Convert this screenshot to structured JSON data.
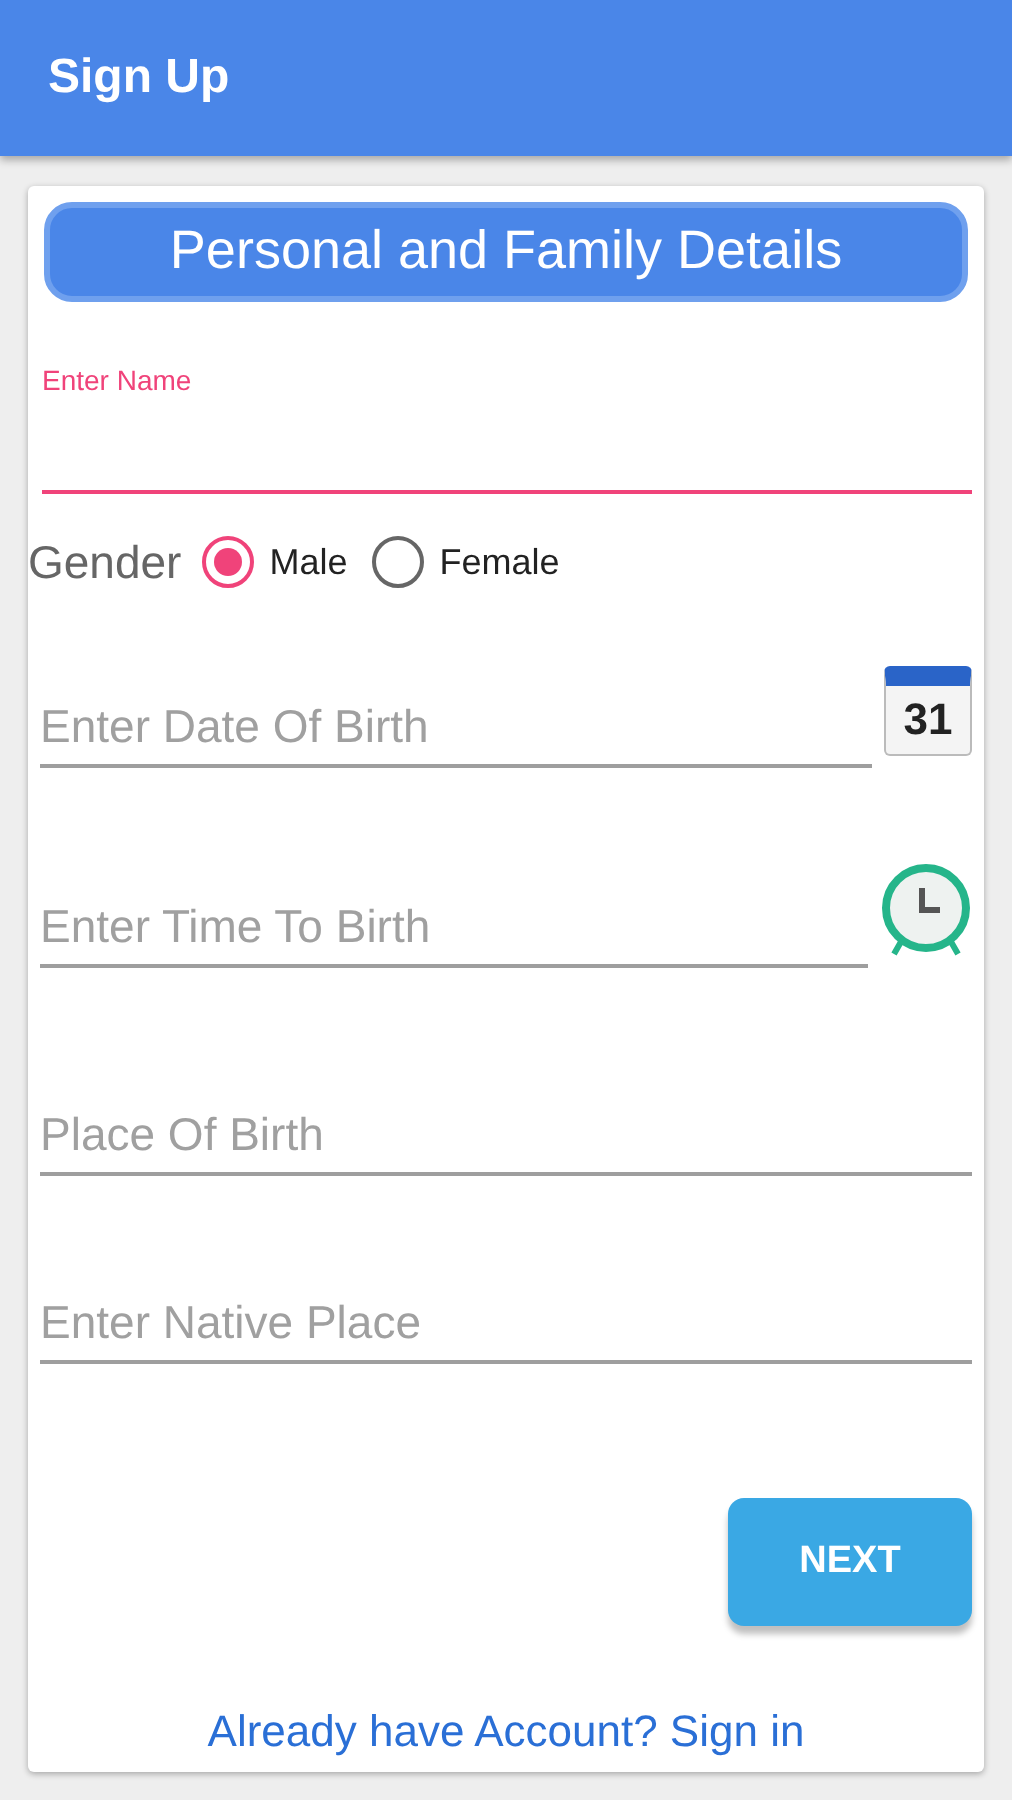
{
  "app_bar": {
    "title": "Sign Up"
  },
  "section_header": "Personal and Family Details",
  "name_field": {
    "label": "Enter Name",
    "focused": true
  },
  "gender": {
    "label": "Gender",
    "options": [
      {
        "label": "Male",
        "selected": true
      },
      {
        "label": "Female",
        "selected": false
      }
    ]
  },
  "fields": [
    {
      "placeholder": "Enter Date Of Birth",
      "kind": "date",
      "icon_text": "31"
    },
    {
      "placeholder": "Enter Time To Birth",
      "kind": "time"
    },
    {
      "placeholder": "Place Of Birth",
      "kind": "text"
    },
    {
      "placeholder": "Enter Native Place",
      "kind": "text"
    }
  ],
  "next_button": "NEXT",
  "sign_in_link": "Already have Account? Sign in"
}
